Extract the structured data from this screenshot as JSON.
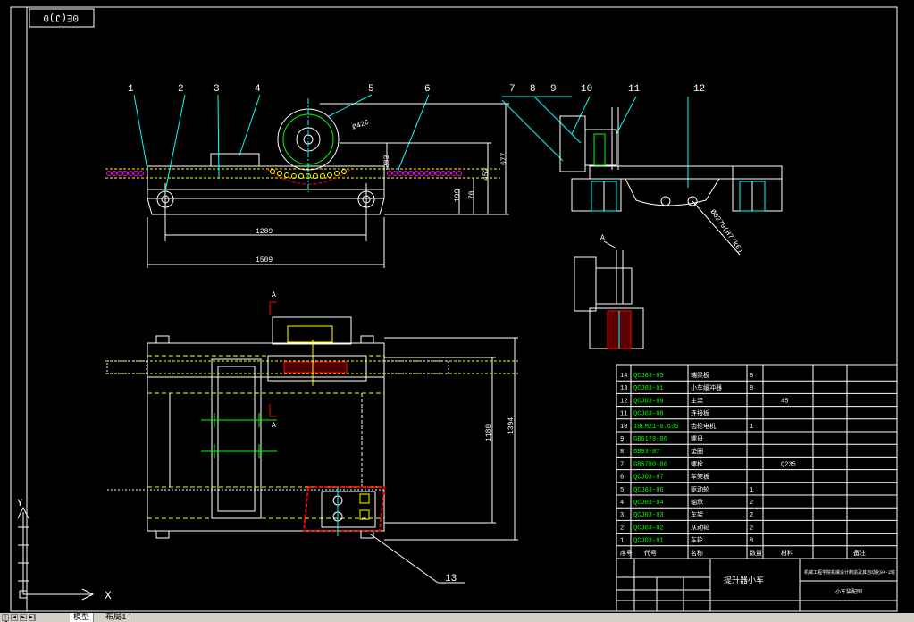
{
  "colors": {
    "background": "#000000",
    "line": "#ffffff",
    "yellow": "#ffff00",
    "cyan": "#00ffff",
    "green": "#00ff00",
    "red": "#ff0000",
    "magenta": "#ff00ff"
  },
  "frame_code": "0E(J)0",
  "callouts": [
    "1",
    "2",
    "3",
    "4",
    "5",
    "6",
    "7",
    "8",
    "9",
    "10",
    "11",
    "12",
    "13"
  ],
  "dimensions": {
    "d_wheel": "Ø426",
    "h_283": "283",
    "h_677": "677",
    "h_452": "452",
    "h_199": "199",
    "h_70": "70",
    "w_1289": "1289",
    "w_1509": "1509",
    "h_1180": "1180",
    "h_1394": "1394",
    "note_spec": "Ø0279(H7/k6)"
  },
  "section_mark": "A",
  "bom": {
    "rows": [
      {
        "no": "14",
        "code": "QCJ03-05",
        "name": "端梁板",
        "qty": "8",
        "mat": "",
        "remark": ""
      },
      {
        "no": "13",
        "code": "QCJ03-01",
        "name": "小车缓冲器",
        "qty": "8",
        "mat": "",
        "remark": ""
      },
      {
        "no": "12",
        "code": "QCJ03-09",
        "name": "主梁",
        "qty": "",
        "mat": "45",
        "remark": ""
      },
      {
        "no": "11",
        "code": "QCJ03-08",
        "name": "连接板",
        "qty": "",
        "mat": "",
        "remark": ""
      },
      {
        "no": "10",
        "code": "10LM21-0.635",
        "name": "齿轮电机",
        "qty": "1",
        "mat": "",
        "remark": ""
      },
      {
        "no": "9",
        "code": "GB6178-86",
        "name": "螺母",
        "qty": "",
        "mat": "",
        "remark": ""
      },
      {
        "no": "8",
        "code": "GB93-87",
        "name": "垫圈",
        "qty": "",
        "mat": "",
        "remark": ""
      },
      {
        "no": "7",
        "code": "GB5780-86",
        "name": "螺栓",
        "qty": "",
        "mat": "Q235",
        "remark": ""
      },
      {
        "no": "6",
        "code": "QCJ03-07",
        "name": "车架板",
        "qty": "",
        "mat": "",
        "remark": ""
      },
      {
        "no": "5",
        "code": "QCJ03-06",
        "name": "驱动轮",
        "qty": "1",
        "mat": "",
        "remark": ""
      },
      {
        "no": "4",
        "code": "QCJ03-04",
        "name": "轴承",
        "qty": "2",
        "mat": "",
        "remark": ""
      },
      {
        "no": "3",
        "code": "QCJ03-03",
        "name": "车架",
        "qty": "2",
        "mat": "",
        "remark": ""
      },
      {
        "no": "2",
        "code": "QCJ03-02",
        "name": "从动轮",
        "qty": "2",
        "mat": "",
        "remark": ""
      },
      {
        "no": "1",
        "code": "QCJ03-01",
        "name": "车轮",
        "qty": "8",
        "mat": "",
        "remark": ""
      }
    ],
    "header": {
      "no": "序号",
      "code": "代号",
      "name": "名称",
      "qty": "数量",
      "mat": "材料",
      "remark": "备注"
    }
  },
  "title_block": {
    "drawing_name": "提升器小车",
    "school": "机械工程学院机械设计制造及其自动化04-2班",
    "designer": "小车装配图"
  },
  "ucs": {
    "x_label": "X",
    "y_label": "Y"
  },
  "tabs": {
    "model": "模型",
    "layout": "布局1"
  }
}
